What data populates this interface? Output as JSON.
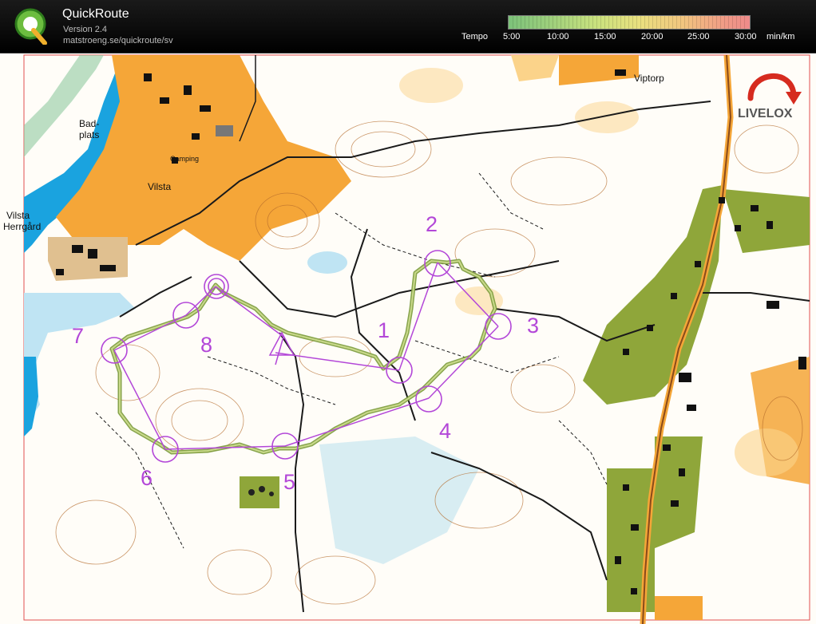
{
  "app": {
    "title": "QuickRoute",
    "version": "Version 2.4",
    "url": "matstroeng.se/quickroute/sv",
    "logo_letter": "Q"
  },
  "tempo": {
    "label": "Tempo",
    "ticks": [
      "5:00",
      "10:00",
      "15:00",
      "20:00",
      "25:00",
      "30:00"
    ],
    "unit": "min/km"
  },
  "map": {
    "place_names": {
      "badplats_1": "Bad-",
      "badplats_2": "plats",
      "vilsta": "Vilsta",
      "vilsta_herrgard_1": "Vilsta",
      "vilsta_herrgard_2": "Herrgård",
      "camping": "Camping",
      "viptorp": "Viptorp"
    },
    "watermark": "LIVELOX",
    "controls": [
      "1",
      "2",
      "3",
      "4",
      "5",
      "6",
      "7",
      "8"
    ],
    "colors": {
      "course": "#b347d8",
      "route": "#7a9a3a",
      "settlement": "#f5a638",
      "open_land": "#fbd38a",
      "green": "#8fa63a",
      "water": "#1aa3df",
      "contour": "#b46a2a"
    }
  }
}
